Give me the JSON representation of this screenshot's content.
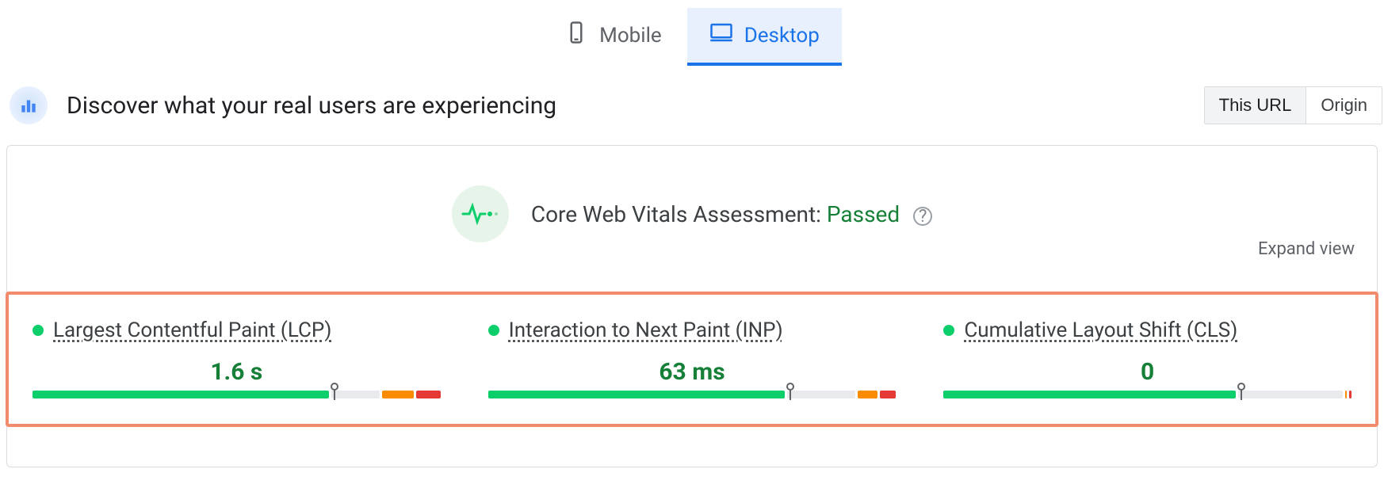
{
  "tabs": {
    "mobile": "Mobile",
    "desktop": "Desktop"
  },
  "subheader": {
    "title": "Discover what your real users are experiencing",
    "toggle_this_url": "This URL",
    "toggle_origin": "Origin"
  },
  "assessment": {
    "label": "Core Web Vitals Assessment:",
    "status": "Passed",
    "expand": "Expand view"
  },
  "metrics": [
    {
      "name": "Largest Contentful Paint (LCP)",
      "value": "1.6 s",
      "dist": {
        "green": 74,
        "gray": 12,
        "orange": 8,
        "red": 6
      },
      "marker_pct": 74
    },
    {
      "name": "Interaction to Next Paint (INP)",
      "value": "63 ms",
      "dist": {
        "green": 74,
        "gray": 17,
        "orange": 5,
        "red": 4
      },
      "marker_pct": 74
    },
    {
      "name": "Cumulative Layout Shift (CLS)",
      "value": "0",
      "dist": {
        "green": 73,
        "gray": 26,
        "orange": 0.5,
        "red": 0.5
      },
      "marker_pct": 73
    }
  ]
}
